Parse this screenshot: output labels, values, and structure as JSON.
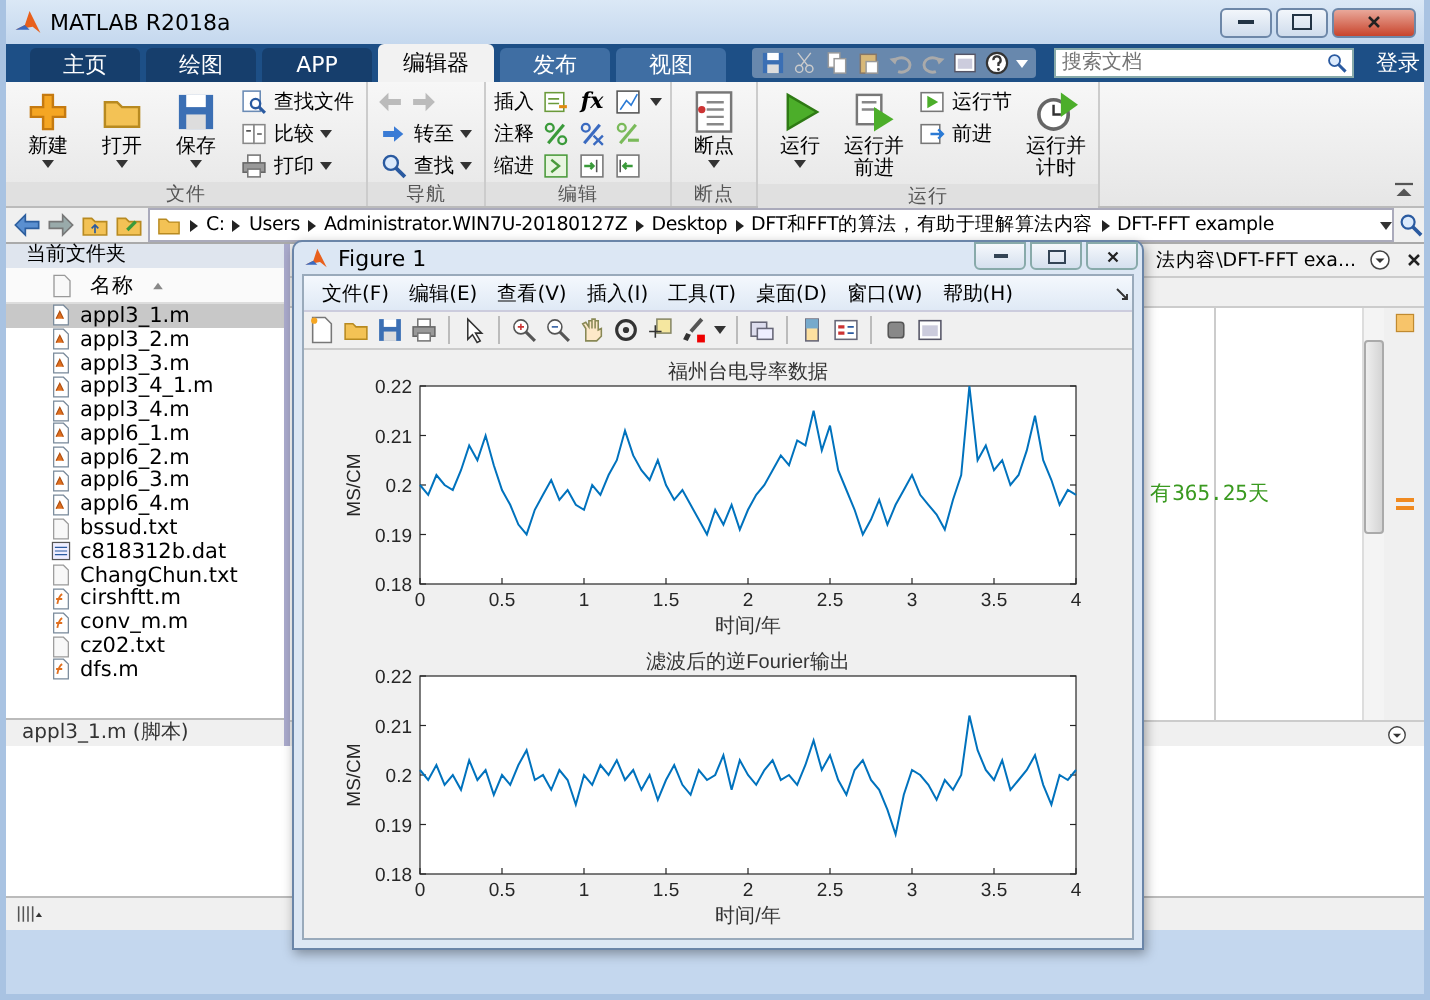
{
  "window": {
    "title": "MATLAB R2018a"
  },
  "tabs": [
    {
      "label": "主页",
      "selected": false
    },
    {
      "label": "绘图",
      "selected": false
    },
    {
      "label": "APP",
      "selected": false
    },
    {
      "label": "编辑器",
      "selected": true
    },
    {
      "label": "发布",
      "selected": false
    },
    {
      "label": "视图",
      "selected": false
    }
  ],
  "search": {
    "placeholder": "搜索文档"
  },
  "login": "登录",
  "ribbon": {
    "groups": [
      {
        "label": "文件",
        "items": [
          {
            "kind": "large",
            "label": "新建",
            "dropdown": true
          },
          {
            "kind": "large",
            "label": "打开",
            "dropdown": true
          },
          {
            "kind": "large",
            "label": "保存",
            "dropdown": true
          },
          {
            "kind": "small",
            "label": "查找文件",
            "dropdown": false
          },
          {
            "kind": "small",
            "label": "比较",
            "dropdown": true
          },
          {
            "kind": "small",
            "label": "打印",
            "dropdown": true
          }
        ]
      },
      {
        "label": "导航",
        "items": [
          {
            "kind": "arrows",
            "disabled": true
          },
          {
            "kind": "small",
            "label": "转至",
            "dropdown": true
          },
          {
            "kind": "small",
            "label": "查找",
            "dropdown": true
          }
        ]
      },
      {
        "label": "编辑",
        "items": [
          {
            "kind": "row",
            "label": "插入",
            "glyph": "fx",
            "dropdown": true
          },
          {
            "kind": "row",
            "label": "注释",
            "dropdown": false
          },
          {
            "kind": "row",
            "label": "缩进",
            "dropdown": false
          }
        ]
      },
      {
        "label": "断点",
        "items": [
          {
            "kind": "large",
            "label": "断点",
            "dropdown": true
          }
        ]
      },
      {
        "label": "运行",
        "items": [
          {
            "kind": "large",
            "label": "运行",
            "dropdown": true
          },
          {
            "kind": "large",
            "label": "运行并前进",
            "dropdown": false
          },
          {
            "kind": "small",
            "label": "运行节",
            "dropdown": false
          },
          {
            "kind": "small",
            "label": "前进",
            "dropdown": false
          },
          {
            "kind": "large",
            "label": "运行并计时",
            "dropdown": false
          }
        ]
      }
    ]
  },
  "address": {
    "segments": [
      "C:",
      "Users",
      "Administrator.WIN7U-20180127Z",
      "Desktop",
      "DFT和FFT的算法，有助于理解算法内容",
      "DFT-FFT example"
    ]
  },
  "files": {
    "title": "当前文件夹",
    "column": "名称",
    "items": [
      {
        "name": "appl3_1.m",
        "kind": "script",
        "selected": true
      },
      {
        "name": "appl3_2.m",
        "kind": "script",
        "selected": false
      },
      {
        "name": "appl3_3.m",
        "kind": "script",
        "selected": false
      },
      {
        "name": "appl3_4_1.m",
        "kind": "script",
        "selected": false
      },
      {
        "name": "appl3_4.m",
        "kind": "script",
        "selected": false
      },
      {
        "name": "appl6_1.m",
        "kind": "script",
        "selected": false
      },
      {
        "name": "appl6_2.m",
        "kind": "script",
        "selected": false
      },
      {
        "name": "appl6_3.m",
        "kind": "script",
        "selected": false
      },
      {
        "name": "appl6_4.m",
        "kind": "script",
        "selected": false
      },
      {
        "name": "bssud.txt",
        "kind": "text",
        "selected": false
      },
      {
        "name": "c818312b.dat",
        "kind": "data",
        "selected": false
      },
      {
        "name": "ChangChun.txt",
        "kind": "text",
        "selected": false
      },
      {
        "name": "cirshftt.m",
        "kind": "function",
        "selected": false
      },
      {
        "name": "conv_m.m",
        "kind": "function",
        "selected": false
      },
      {
        "name": "cz02.txt",
        "kind": "text",
        "selected": false
      },
      {
        "name": "dfs.m",
        "kind": "function",
        "selected": false
      }
    ],
    "detail": "appl3_1.m  (脚本)"
  },
  "editor": {
    "tab": "法内容\\DFT-FFT exa...",
    "line": "有365.25天"
  },
  "figure": {
    "title": "Figure 1",
    "menus": [
      "文件(F)",
      "编辑(E)",
      "查看(V)",
      "插入(I)",
      "工具(T)",
      "桌面(D)",
      "窗口(W)",
      "帮助(H)"
    ],
    "charts": [
      {
        "chart_data": {
          "type": "line",
          "title": "福州台电导率数据",
          "xlabel": "时间/年",
          "ylabel": "MS/CM",
          "xlim": [
            0,
            4
          ],
          "ylim": [
            0.18,
            0.22
          ],
          "xticks": [
            0,
            0.5,
            1,
            1.5,
            2,
            2.5,
            3,
            3.5,
            4
          ],
          "yticks": [
            0.18,
            0.19,
            0.2,
            0.21,
            0.22
          ],
          "x": [
            0,
            0.05,
            0.1,
            0.15,
            0.2,
            0.25,
            0.3,
            0.35,
            0.4,
            0.45,
            0.5,
            0.55,
            0.6,
            0.65,
            0.7,
            0.75,
            0.8,
            0.85,
            0.9,
            0.95,
            1,
            1.05,
            1.1,
            1.15,
            1.2,
            1.25,
            1.3,
            1.35,
            1.4,
            1.45,
            1.5,
            1.55,
            1.6,
            1.65,
            1.7,
            1.75,
            1.8,
            1.85,
            1.9,
            1.95,
            2,
            2.05,
            2.1,
            2.15,
            2.2,
            2.25,
            2.3,
            2.35,
            2.4,
            2.45,
            2.5,
            2.55,
            2.6,
            2.65,
            2.7,
            2.75,
            2.8,
            2.85,
            2.9,
            2.95,
            3,
            3.05,
            3.1,
            3.15,
            3.2,
            3.25,
            3.3,
            3.35,
            3.4,
            3.45,
            3.5,
            3.55,
            3.6,
            3.65,
            3.7,
            3.75,
            3.8,
            3.85,
            3.9,
            3.95,
            4
          ],
          "series": [
            {
              "color": "#0072bd",
              "values": [
                0.2,
                0.198,
                0.202,
                0.2,
                0.199,
                0.203,
                0.208,
                0.205,
                0.21,
                0.204,
                0.199,
                0.196,
                0.192,
                0.19,
                0.195,
                0.198,
                0.201,
                0.197,
                0.199,
                0.196,
                0.195,
                0.2,
                0.198,
                0.202,
                0.205,
                0.211,
                0.206,
                0.203,
                0.201,
                0.205,
                0.2,
                0.197,
                0.199,
                0.196,
                0.193,
                0.19,
                0.195,
                0.192,
                0.196,
                0.191,
                0.195,
                0.198,
                0.2,
                0.203,
                0.206,
                0.204,
                0.209,
                0.208,
                0.215,
                0.207,
                0.212,
                0.203,
                0.199,
                0.195,
                0.19,
                0.193,
                0.197,
                0.192,
                0.196,
                0.199,
                0.202,
                0.198,
                0.196,
                0.194,
                0.191,
                0.197,
                0.202,
                0.22,
                0.205,
                0.208,
                0.203,
                0.205,
                0.2,
                0.202,
                0.207,
                0.214,
                0.205,
                0.201,
                0.196,
                0.199,
                0.198
              ]
            }
          ]
        }
      },
      {
        "chart_data": {
          "type": "line",
          "title": "滤波后的逆Fourier输出",
          "xlabel": "时间/年",
          "ylabel": "MS/CM",
          "xlim": [
            0,
            4
          ],
          "ylim": [
            0.18,
            0.22
          ],
          "xticks": [
            0,
            0.5,
            1,
            1.5,
            2,
            2.5,
            3,
            3.5,
            4
          ],
          "yticks": [
            0.18,
            0.19,
            0.2,
            0.21,
            0.22
          ],
          "x": [
            0,
            0.05,
            0.1,
            0.15,
            0.2,
            0.25,
            0.3,
            0.35,
            0.4,
            0.45,
            0.5,
            0.55,
            0.6,
            0.65,
            0.7,
            0.75,
            0.8,
            0.85,
            0.9,
            0.95,
            1,
            1.05,
            1.1,
            1.15,
            1.2,
            1.25,
            1.3,
            1.35,
            1.4,
            1.45,
            1.5,
            1.55,
            1.6,
            1.65,
            1.7,
            1.75,
            1.8,
            1.85,
            1.9,
            1.95,
            2,
            2.05,
            2.1,
            2.15,
            2.2,
            2.25,
            2.3,
            2.35,
            2.4,
            2.45,
            2.5,
            2.55,
            2.6,
            2.65,
            2.7,
            2.75,
            2.8,
            2.85,
            2.9,
            2.95,
            3,
            3.05,
            3.1,
            3.15,
            3.2,
            3.25,
            3.3,
            3.35,
            3.4,
            3.45,
            3.5,
            3.55,
            3.6,
            3.65,
            3.7,
            3.75,
            3.8,
            3.85,
            3.9,
            3.95,
            4
          ],
          "series": [
            {
              "color": "#0072bd",
              "values": [
                0.201,
                0.199,
                0.202,
                0.198,
                0.2,
                0.197,
                0.203,
                0.199,
                0.201,
                0.196,
                0.2,
                0.198,
                0.202,
                0.205,
                0.199,
                0.2,
                0.197,
                0.201,
                0.199,
                0.194,
                0.2,
                0.198,
                0.202,
                0.2,
                0.203,
                0.199,
                0.201,
                0.197,
                0.2,
                0.195,
                0.199,
                0.202,
                0.198,
                0.196,
                0.201,
                0.199,
                0.2,
                0.204,
                0.197,
                0.203,
                0.2,
                0.198,
                0.201,
                0.203,
                0.199,
                0.2,
                0.198,
                0.202,
                0.207,
                0.201,
                0.204,
                0.199,
                0.196,
                0.201,
                0.203,
                0.199,
                0.197,
                0.193,
                0.188,
                0.196,
                0.201,
                0.2,
                0.198,
                0.195,
                0.199,
                0.197,
                0.2,
                0.212,
                0.205,
                0.201,
                0.199,
                0.203,
                0.197,
                0.199,
                0.201,
                0.204,
                0.198,
                0.194,
                0.2,
                0.199,
                0.201
              ]
            }
          ]
        }
      }
    ]
  }
}
